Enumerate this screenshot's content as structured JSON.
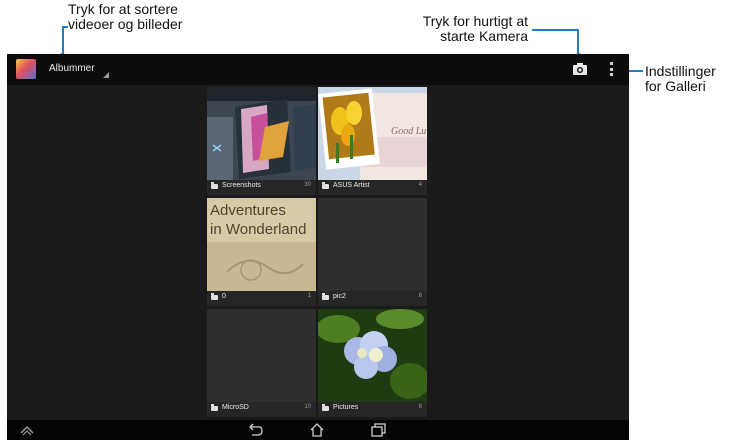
{
  "callouts": {
    "sort_line1": "Tryk for at sortere",
    "sort_line2": "videoer og billeder",
    "camera_line1": "Tryk for hurtigt at",
    "camera_line2": "starte Kamera",
    "settings_line1": "Indstillinger",
    "settings_line2": "for Galleri"
  },
  "action_bar": {
    "album_label": "Albummer",
    "icons": [
      "gallery-app-icon",
      "camera-icon",
      "overflow-menu-icon"
    ]
  },
  "albums": [
    {
      "name": "Screenshots",
      "count": "30"
    },
    {
      "name": "ASUS Artist",
      "count": "4"
    },
    {
      "name": "0",
      "count": "1",
      "cover_line1": "Adventures",
      "cover_line2": "in Wonderland"
    },
    {
      "name": "pic2",
      "count": "6"
    },
    {
      "name": "MicroSD",
      "count": "10"
    },
    {
      "name": "Pictures",
      "count": "8"
    }
  ],
  "asus_artist_cover_text": "Good Lu",
  "nav_bar": {
    "icons": [
      "home-up-icon",
      "back-icon",
      "home-icon",
      "recent-apps-icon"
    ]
  },
  "colors": {
    "callout_line": "#1e7fc6",
    "background": "#1a1a1a",
    "action_bar": "#0d0d0d"
  }
}
